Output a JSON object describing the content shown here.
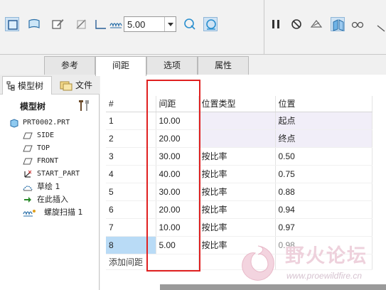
{
  "ribbon": {
    "value": "5.00",
    "icons": [
      "surface-icon",
      "surface-open-icon",
      "sketch-edit-icon",
      "trim-icon",
      "spacing-icon",
      "helix-spring-icon",
      "drag-icon",
      "attach-icon",
      "pause-icon",
      "no-icon",
      "preview-icon",
      "verify-icon",
      "glasses-icon"
    ]
  },
  "tabs": [
    {
      "label": "参考"
    },
    {
      "label": "间距"
    },
    {
      "label": "选项"
    },
    {
      "label": "属性"
    }
  ],
  "tree": {
    "tabs": {
      "model_tree": "模型树",
      "files": "文件"
    },
    "header": "模型树",
    "items": [
      {
        "label": "PRT0002.PRT",
        "icon": "part-icon"
      },
      {
        "label": "SIDE",
        "icon": "datum-plane-icon"
      },
      {
        "label": "TOP",
        "icon": "datum-plane-icon"
      },
      {
        "label": "FRONT",
        "icon": "datum-plane-icon"
      },
      {
        "label": "START_PART",
        "icon": "coordinate-system-icon"
      },
      {
        "label": "草绘 1",
        "icon": "sketch-icon"
      },
      {
        "label": "在此插入",
        "icon": "insert-arrow-icon"
      },
      {
        "label": "螺旋扫描 1",
        "icon": "helical-sweep-icon"
      }
    ]
  },
  "spacing_table": {
    "headers": [
      "#",
      "间距",
      "位置类型",
      "位置"
    ],
    "rows": [
      {
        "num": "1",
        "spacing": "10.00",
        "type": "",
        "position": "起点"
      },
      {
        "num": "2",
        "spacing": "20.00",
        "type": "",
        "position": "终点"
      },
      {
        "num": "3",
        "spacing": "30.00",
        "type": "按比率",
        "position": "0.50"
      },
      {
        "num": "4",
        "spacing": "40.00",
        "type": "按比率",
        "position": "0.75"
      },
      {
        "num": "5",
        "spacing": "30.00",
        "type": "按比率",
        "position": "0.88"
      },
      {
        "num": "6",
        "spacing": "20.00",
        "type": "按比率",
        "position": "0.94"
      },
      {
        "num": "7",
        "spacing": "10.00",
        "type": "按比率",
        "position": "0.97"
      },
      {
        "num": "8",
        "spacing": "5.00",
        "type": "按比率",
        "position": "0.98"
      }
    ],
    "add_label": "添加间距"
  },
  "watermark": {
    "title": "野火论坛",
    "url": "www.proewildfire.cn"
  },
  "colors": {
    "highlight": "#e02020",
    "selected_cell": "#b9dbf6",
    "shaded_cell": "#f1eef8"
  }
}
